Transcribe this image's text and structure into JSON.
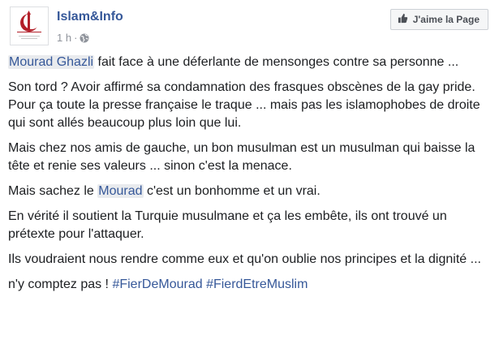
{
  "page": {
    "name": "Islam&Info",
    "time": "1 h",
    "separator": "·",
    "globe_icon": "globe-icon",
    "avatar_text": "Islam&Info",
    "like_button_label": "J'aime la Page",
    "like_icon": "thumbs-up-icon"
  },
  "post": {
    "p1": {
      "mention": "Mourad Ghazli",
      "text": " fait face à une déferlante de mensonges contre sa personne ..."
    },
    "p2": "Son tord ? Avoir affirmé sa condamnation des frasques obscènes de la gay pride. Pour ça toute la presse française le traque ... mais pas les islamophobes de droite qui sont allés beaucoup plus loin que lui.",
    "p3": "Mais chez nos amis de gauche, un bon musulman est un musulman qui baisse la tête et renie ses valeurs ... sinon c'est la menace.",
    "p4": {
      "before": "Mais sachez le ",
      "mention": "Mourad",
      "after": " c'est un bonhomme et un vrai."
    },
    "p5": "En vérité il soutient la Turquie musulmane et ça les embête, ils ont trouvé un prétexte pour l'attaquer.",
    "p6": "Ils voudraient nous rendre comme eux et qu'on oublie nos principes et la dignité ...",
    "p7": {
      "text": "n'y comptez pas ! ",
      "hashtag1": "#FierDeMourad",
      "space": " ",
      "hashtag2": "#FierdEtreMuslim"
    }
  },
  "colors": {
    "link": "#365899",
    "meta": "#90949c",
    "text": "#1c1e21",
    "logo_red": "#b3202a"
  }
}
